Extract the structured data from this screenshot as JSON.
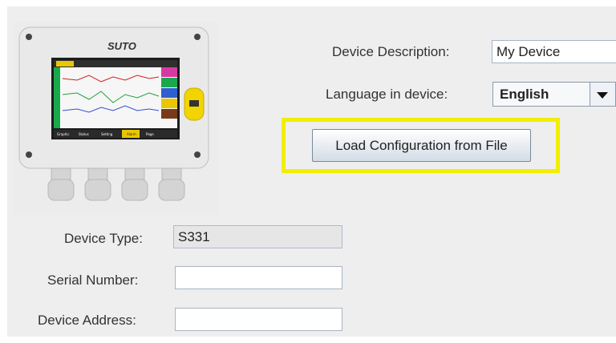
{
  "device_image": {
    "brand_logo": "SUTO",
    "screen_tabs": [
      "Graphic",
      "Status",
      "Setting",
      "Alarm",
      "Page"
    ]
  },
  "device_description": {
    "label": "Device Description:",
    "value": "My Device"
  },
  "language": {
    "label": "Language in device:",
    "value": "English"
  },
  "load_button": {
    "label": "Load Configuration from File",
    "highlight_color": "#f2ee00"
  },
  "device_type": {
    "label": "Device Type:",
    "value": "S331"
  },
  "serial_number": {
    "label": "Serial Number:",
    "value": ""
  },
  "device_address": {
    "label": "Device Address:",
    "value": ""
  }
}
